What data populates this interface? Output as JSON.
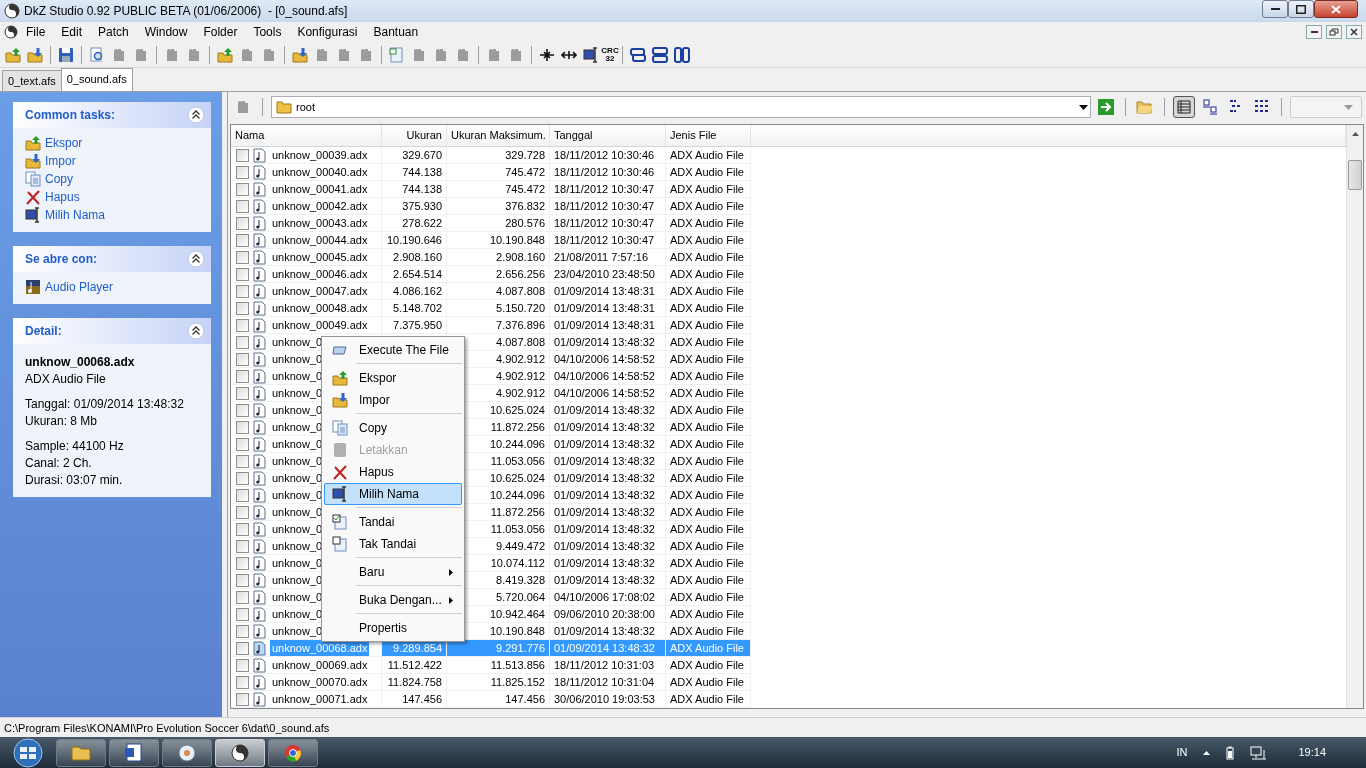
{
  "window": {
    "title": "DkZ Studio 0.92 PUBLIC BETA (01/06/2006)  - [0_sound.afs]"
  },
  "menu_bar": [
    "File",
    "Edit",
    "Patch",
    "Window",
    "Folder",
    "Tools",
    "Konfigurasi",
    "Bantuan"
  ],
  "toolbar": [
    [
      {
        "disabled": false
      },
      {
        "disabled": false
      }
    ],
    [
      {
        "disabled": false
      }
    ],
    [
      {
        "disabled": false
      },
      {
        "disabled": true
      },
      {
        "disabled": true
      }
    ],
    [
      {
        "disabled": true
      },
      {
        "disabled": true
      }
    ],
    [
      {
        "disabled": false
      },
      {
        "disabled": true
      },
      {
        "disabled": true
      }
    ],
    [
      {
        "disabled": false
      },
      {
        "disabled": true
      },
      {
        "disabled": true
      },
      {
        "disabled": true
      }
    ],
    [
      {
        "disabled": false
      },
      {
        "disabled": true
      },
      {
        "disabled": true
      },
      {
        "disabled": true
      }
    ],
    [
      {
        "disabled": true
      },
      {
        "disabled": true
      }
    ],
    [
      {
        "disabled": false
      },
      {
        "disabled": false
      },
      {
        "disabled": false
      },
      {
        "disabled": false,
        "label": "CRC 32"
      }
    ],
    [
      {
        "disabled": false
      },
      {
        "disabled": false
      },
      {
        "disabled": false
      }
    ]
  ],
  "document_tabs": [
    {
      "label": "0_text.afs",
      "selected": false
    },
    {
      "label": "0_sound.afs",
      "selected": true
    }
  ],
  "task_panes": [
    {
      "title": "Common tasks:",
      "kind": "links",
      "items": [
        "Ekspor",
        "Impor",
        "Copy",
        "Hapus",
        "Milih Nama"
      ]
    },
    {
      "title": "Se abre con:",
      "kind": "links",
      "items": [
        "Audio Player"
      ]
    },
    {
      "title": "Detail:",
      "kind": "detail",
      "name": "unknow_00068.adx",
      "type": "ADX Audio File",
      "groups": [
        [
          "Tanggal: 01/09/2014 13:48:32",
          "Ukuran: 8 Mb"
        ],
        [
          "Sample: 44100 Hz",
          "Canal: 2 Ch.",
          "Durasi: 03:07 min."
        ]
      ]
    }
  ],
  "address_bar": {
    "path": "root"
  },
  "view_buttons": [
    {
      "selected": true
    },
    {
      "selected": false
    },
    {
      "selected": false
    },
    {
      "selected": false
    }
  ],
  "table": {
    "columns": [
      "Nama",
      "Ukuran",
      "Ukuran Maksimum.",
      "Tanggal",
      "Jenis File"
    ],
    "rows": [
      {
        "name": "unknow_00039.adx",
        "size": "329.670",
        "max": "329.728",
        "date": "18/11/2012 10:30:46",
        "type": "ADX Audio File",
        "checked": false,
        "selected": false
      },
      {
        "name": "unknow_00040.adx",
        "size": "744.138",
        "max": "745.472",
        "date": "18/11/2012 10:30:46",
        "type": "ADX Audio File",
        "checked": false,
        "selected": false
      },
      {
        "name": "unknow_00041.adx",
        "size": "744.138",
        "max": "745.472",
        "date": "18/11/2012 10:30:47",
        "type": "ADX Audio File",
        "checked": false,
        "selected": false
      },
      {
        "name": "unknow_00042.adx",
        "size": "375.930",
        "max": "376.832",
        "date": "18/11/2012 10:30:47",
        "type": "ADX Audio File",
        "checked": false,
        "selected": false
      },
      {
        "name": "unknow_00043.adx",
        "size": "278.622",
        "max": "280.576",
        "date": "18/11/2012 10:30:47",
        "type": "ADX Audio File",
        "checked": false,
        "selected": false
      },
      {
        "name": "unknow_00044.adx",
        "size": "10.190.646",
        "max": "10.190.848",
        "date": "18/11/2012 10:30:47",
        "type": "ADX Audio File",
        "checked": false,
        "selected": false
      },
      {
        "name": "unknow_00045.adx",
        "size": "2.908.160",
        "max": "2.908.160",
        "date": "21/08/2011 7:57:16",
        "type": "ADX Audio File",
        "checked": false,
        "selected": false
      },
      {
        "name": "unknow_00046.adx",
        "size": "2.654.514",
        "max": "2.656.256",
        "date": "23/04/2010 23:48:50",
        "type": "ADX Audio File",
        "checked": false,
        "selected": false
      },
      {
        "name": "unknow_00047.adx",
        "size": "4.086.162",
        "max": "4.087.808",
        "date": "01/09/2014 13:48:31",
        "type": "ADX Audio File",
        "checked": false,
        "selected": false
      },
      {
        "name": "unknow_00048.adx",
        "size": "5.148.702",
        "max": "5.150.720",
        "date": "01/09/2014 13:48:31",
        "type": "ADX Audio File",
        "checked": false,
        "selected": false
      },
      {
        "name": "unknow_00049.adx",
        "size": "7.375.950",
        "max": "7.376.896",
        "date": "01/09/2014 13:48:31",
        "type": "ADX Audio File",
        "checked": false,
        "selected": false
      },
      {
        "name": "unknow_0",
        "max": "4.087.808",
        "date": "01/09/2014 13:48:32",
        "type": "ADX Audio File",
        "checked": false,
        "selected": false
      },
      {
        "name": "unknow_0",
        "max": "4.902.912",
        "date": "04/10/2006 14:58:52",
        "type": "ADX Audio File",
        "checked": false,
        "selected": false
      },
      {
        "name": "unknow_0",
        "max": "4.902.912",
        "date": "04/10/2006 14:58:52",
        "type": "ADX Audio File",
        "checked": false,
        "selected": false
      },
      {
        "name": "unknow_0",
        "max": "4.902.912",
        "date": "04/10/2006 14:58:52",
        "type": "ADX Audio File",
        "checked": false,
        "selected": false
      },
      {
        "name": "unknow_0",
        "max": "10.625.024",
        "date": "01/09/2014 13:48:32",
        "type": "ADX Audio File",
        "checked": false,
        "selected": false
      },
      {
        "name": "unknow_0",
        "max": "11.872.256",
        "date": "01/09/2014 13:48:32",
        "type": "ADX Audio File",
        "checked": false,
        "selected": false
      },
      {
        "name": "unknow_0",
        "max": "10.244.096",
        "date": "01/09/2014 13:48:32",
        "type": "ADX Audio File",
        "checked": false,
        "selected": false
      },
      {
        "name": "unknow_0",
        "max": "11.053.056",
        "date": "01/09/2014 13:48:32",
        "type": "ADX Audio File",
        "checked": false,
        "selected": false
      },
      {
        "name": "unknow_0",
        "max": "10.625.024",
        "date": "01/09/2014 13:48:32",
        "type": "ADX Audio File",
        "checked": false,
        "selected": false
      },
      {
        "name": "unknow_0",
        "max": "10.244.096",
        "date": "01/09/2014 13:48:32",
        "type": "ADX Audio File",
        "checked": false,
        "selected": false
      },
      {
        "name": "unknow_0",
        "max": "11.872.256",
        "date": "01/09/2014 13:48:32",
        "type": "ADX Audio File",
        "checked": false,
        "selected": false
      },
      {
        "name": "unknow_0",
        "max": "11.053.056",
        "date": "01/09/2014 13:48:32",
        "type": "ADX Audio File",
        "checked": false,
        "selected": false
      },
      {
        "name": "unknow_0",
        "max": "9.449.472",
        "date": "01/09/2014 13:48:32",
        "type": "ADX Audio File",
        "checked": false,
        "selected": false
      },
      {
        "name": "unknow_0",
        "max": "10.074.112",
        "date": "01/09/2014 13:48:32",
        "type": "ADX Audio File",
        "checked": false,
        "selected": false
      },
      {
        "name": "unknow_0",
        "max": "8.419.328",
        "date": "01/09/2014 13:48:32",
        "type": "ADX Audio File",
        "checked": false,
        "selected": false
      },
      {
        "name": "unknow_0",
        "max": "5.720.064",
        "date": "04/10/2006 17:08:02",
        "type": "ADX Audio File",
        "checked": false,
        "selected": false
      },
      {
        "name": "unknow_0",
        "max": "10.942.464",
        "date": "09/06/2010 20:38:00",
        "type": "ADX Audio File",
        "checked": false,
        "selected": false
      },
      {
        "name": "unknow_0",
        "max": "10.190.848",
        "date": "01/09/2014 13:48:32",
        "type": "ADX Audio File",
        "checked": false,
        "selected": false
      },
      {
        "name": "unknow_00068.adx",
        "size": "9.289.854",
        "max": "9.291.776",
        "date": "01/09/2014 13:48:32",
        "type": "ADX Audio File",
        "checked": false,
        "selected": true
      },
      {
        "name": "unknow_00069.adx",
        "size": "11.512.422",
        "max": "11.513.856",
        "date": "18/11/2012 10:31:03",
        "type": "ADX Audio File",
        "checked": false,
        "selected": false
      },
      {
        "name": "unknow_00070.adx",
        "size": "11.824.758",
        "max": "11.825.152",
        "date": "18/11/2012 10:31:04",
        "type": "ADX Audio File",
        "checked": false,
        "selected": false
      },
      {
        "name": "unknow_00071.adx",
        "size": "147.456",
        "max": "147.456",
        "date": "30/06/2010 19:03:53",
        "type": "ADX Audio File",
        "checked": false,
        "selected": false
      }
    ]
  },
  "context_menu": {
    "items": [
      {
        "kind": "item",
        "label": "Execute The File",
        "disabled": false,
        "selected": false,
        "submenu": false
      },
      {
        "kind": "separator"
      },
      {
        "kind": "item",
        "label": "Ekspor",
        "disabled": false,
        "selected": false,
        "submenu": false
      },
      {
        "kind": "item",
        "label": "Impor",
        "disabled": false,
        "selected": false,
        "submenu": false
      },
      {
        "kind": "separator"
      },
      {
        "kind": "item",
        "label": "Copy",
        "disabled": false,
        "selected": false,
        "submenu": false
      },
      {
        "kind": "item",
        "label": "Letakkan",
        "disabled": true,
        "selected": false,
        "submenu": false
      },
      {
        "kind": "item",
        "label": "Hapus",
        "disabled": false,
        "selected": false,
        "submenu": false
      },
      {
        "kind": "item",
        "label": "Milih Nama",
        "disabled": false,
        "selected": true,
        "submenu": false
      },
      {
        "kind": "separator"
      },
      {
        "kind": "item",
        "label": "Tandai",
        "disabled": false,
        "selected": false,
        "submenu": false
      },
      {
        "kind": "item",
        "label": "Tak Tandai",
        "disabled": false,
        "selected": false,
        "submenu": false
      },
      {
        "kind": "separator"
      },
      {
        "kind": "item",
        "label": "Baru",
        "disabled": false,
        "selected": false,
        "submenu": true
      },
      {
        "kind": "separator"
      },
      {
        "kind": "item",
        "label": "Buka Dengan...",
        "disabled": false,
        "selected": false,
        "submenu": true
      },
      {
        "kind": "separator"
      },
      {
        "kind": "item",
        "label": "Propertis",
        "disabled": false,
        "selected": false,
        "submenu": false
      }
    ]
  },
  "status_bar": "C:\\Program Files\\KONAMI\\Pro Evolution Soccer 6\\dat\\0_sound.afs",
  "taskbar": {
    "buttons": [
      {
        "selected": false
      },
      {
        "selected": false
      },
      {
        "selected": false
      },
      {
        "selected": true
      },
      {
        "selected": false
      }
    ],
    "language": "IN",
    "clock": "19:14"
  }
}
